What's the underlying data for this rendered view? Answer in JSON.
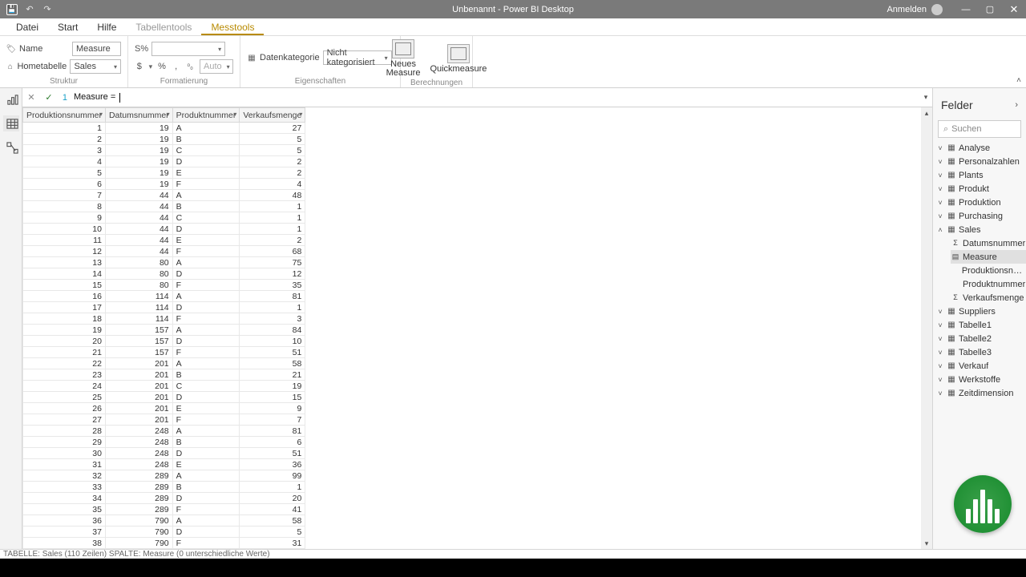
{
  "titlebar": {
    "title": "Unbenannt - Power BI Desktop",
    "signin": "Anmelden"
  },
  "menu": {
    "file": "Datei",
    "start": "Start",
    "help": "Hilfe",
    "tabletools": "Tabellentools",
    "measuretools": "Messtools"
  },
  "ribbon": {
    "struct_label": "Struktur",
    "name_label": "Name",
    "name_value": "Measure",
    "home_label": "Hometabelle",
    "home_value": "Sales",
    "fmt_label": "Formatierung",
    "fmt_pct": "S%",
    "fmt_dollar": "$",
    "fmt_pct2": "%",
    "fmt_comma": ",",
    "fmt_auto": "Auto",
    "props_label": "Eigenschaften",
    "datacat_label": "Datenkategorie",
    "datacat_value": "Nicht kategorisiert",
    "calc_label": "Berechnungen",
    "new_measure": "Neues\nMeasure",
    "quick_measure": "Quickmeasure"
  },
  "formula": {
    "line": "1",
    "text": "Measure = "
  },
  "columns": [
    "Produktionsnummer",
    "Datumsnummer",
    "Produktnummer",
    "Verkaufsmenge"
  ],
  "rows": [
    [
      1,
      19,
      "A",
      27
    ],
    [
      2,
      19,
      "B",
      5
    ],
    [
      3,
      19,
      "C",
      5
    ],
    [
      4,
      19,
      "D",
      2
    ],
    [
      5,
      19,
      "E",
      2
    ],
    [
      6,
      19,
      "F",
      4
    ],
    [
      7,
      44,
      "A",
      48
    ],
    [
      8,
      44,
      "B",
      1
    ],
    [
      9,
      44,
      "C",
      1
    ],
    [
      10,
      44,
      "D",
      1
    ],
    [
      11,
      44,
      "E",
      2
    ],
    [
      12,
      44,
      "F",
      68
    ],
    [
      13,
      80,
      "A",
      75
    ],
    [
      14,
      80,
      "D",
      12
    ],
    [
      15,
      80,
      "F",
      35
    ],
    [
      16,
      114,
      "A",
      81
    ],
    [
      17,
      114,
      "D",
      1
    ],
    [
      18,
      114,
      "F",
      3
    ],
    [
      19,
      157,
      "A",
      84
    ],
    [
      20,
      157,
      "D",
      10
    ],
    [
      21,
      157,
      "F",
      51
    ],
    [
      22,
      201,
      "A",
      58
    ],
    [
      23,
      201,
      "B",
      21
    ],
    [
      24,
      201,
      "C",
      19
    ],
    [
      25,
      201,
      "D",
      15
    ],
    [
      26,
      201,
      "E",
      9
    ],
    [
      27,
      201,
      "F",
      7
    ],
    [
      28,
      248,
      "A",
      81
    ],
    [
      29,
      248,
      "B",
      6
    ],
    [
      30,
      248,
      "D",
      51
    ],
    [
      31,
      248,
      "E",
      36
    ],
    [
      32,
      289,
      "A",
      99
    ],
    [
      33,
      289,
      "B",
      1
    ],
    [
      34,
      289,
      "D",
      20
    ],
    [
      35,
      289,
      "F",
      41
    ],
    [
      36,
      790,
      "A",
      58
    ],
    [
      37,
      790,
      "D",
      5
    ],
    [
      38,
      790,
      "F",
      31
    ]
  ],
  "fields": {
    "title": "Felder",
    "search": "Suchen",
    "tables": [
      "Analyse",
      "Personalzahlen",
      "Plants",
      "Produkt",
      "Produktion",
      "Purchasing"
    ],
    "sales": {
      "name": "Sales",
      "cols": [
        "Datumsnummer",
        "Measure",
        "Produktionsnum...",
        "Produktnummer",
        "Verkaufsmenge"
      ]
    },
    "tables_after": [
      "Suppliers",
      "Tabelle1",
      "Tabelle2",
      "Tabelle3",
      "Verkauf",
      "Werkstoffe",
      "Zeitdimension"
    ]
  },
  "status": "TABELLE: Sales (110 Zeilen) SPALTE: Measure (0 unterschiedliche Werte)"
}
